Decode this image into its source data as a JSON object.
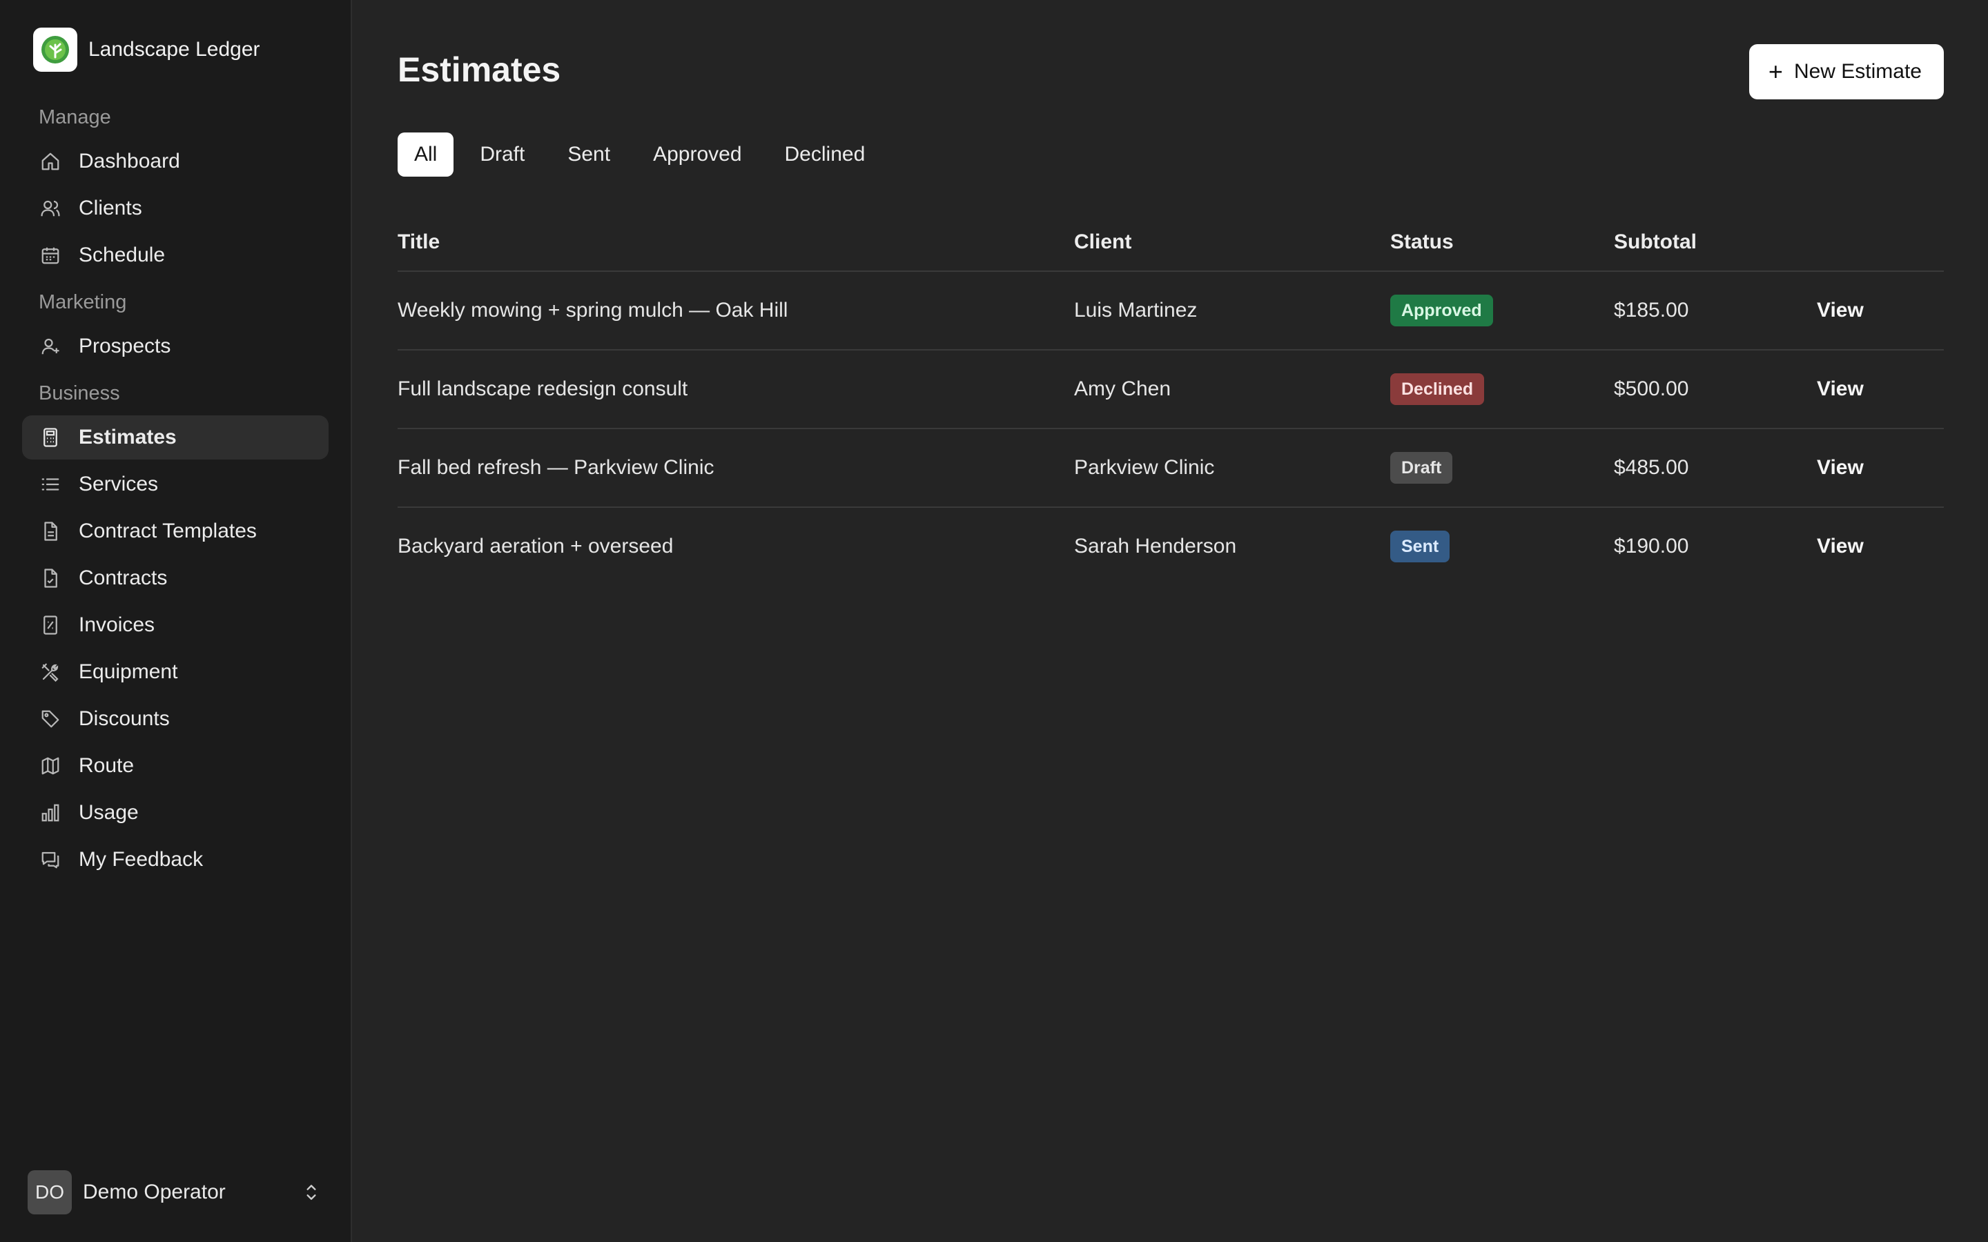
{
  "app": {
    "name": "Landscape Ledger"
  },
  "sidebar": {
    "sections": [
      {
        "label": "Manage",
        "items": [
          {
            "label": "Dashboard",
            "icon": "home-icon"
          },
          {
            "label": "Clients",
            "icon": "users-icon"
          },
          {
            "label": "Schedule",
            "icon": "calendar-icon"
          }
        ]
      },
      {
        "label": "Marketing",
        "items": [
          {
            "label": "Prospects",
            "icon": "user-plus-icon"
          }
        ]
      },
      {
        "label": "Business",
        "items": [
          {
            "label": "Estimates",
            "icon": "calculator-icon",
            "active": true
          },
          {
            "label": "Services",
            "icon": "list-icon"
          },
          {
            "label": "Contract Templates",
            "icon": "file-icon"
          },
          {
            "label": "Contracts",
            "icon": "file-check-icon"
          },
          {
            "label": "Invoices",
            "icon": "receipt-icon"
          },
          {
            "label": "Equipment",
            "icon": "tools-icon"
          },
          {
            "label": "Discounts",
            "icon": "tag-icon"
          },
          {
            "label": "Route",
            "icon": "map-icon"
          },
          {
            "label": "Usage",
            "icon": "bar-chart-icon"
          },
          {
            "label": "My Feedback",
            "icon": "feedback-icon"
          }
        ]
      }
    ],
    "user": {
      "initials": "DO",
      "name": "Demo Operator"
    }
  },
  "main": {
    "title": "Estimates",
    "new_button": "New Estimate",
    "tabs": [
      "All",
      "Draft",
      "Sent",
      "Approved",
      "Declined"
    ],
    "active_tab": "All",
    "columns": {
      "title": "Title",
      "client": "Client",
      "status": "Status",
      "subtotal": "Subtotal"
    },
    "rows": [
      {
        "title": "Weekly mowing + spring mulch — Oak Hill",
        "client": "Luis Martinez",
        "status": "Approved",
        "subtotal": "$185.00",
        "action": "View"
      },
      {
        "title": "Full landscape redesign consult",
        "client": "Amy Chen",
        "status": "Declined",
        "subtotal": "$500.00",
        "action": "View"
      },
      {
        "title": "Fall bed refresh — Parkview Clinic",
        "client": "Parkview Clinic",
        "status": "Draft",
        "subtotal": "$485.00",
        "action": "View"
      },
      {
        "title": "Backyard aeration + overseed",
        "client": "Sarah Henderson",
        "status": "Sent",
        "subtotal": "$190.00",
        "action": "View"
      }
    ]
  },
  "colors": {
    "background": "#242424",
    "sidebar": "#1b1b1b",
    "status": {
      "Approved": {
        "bg": "#1f7a45",
        "fg": "#d9f7e4"
      },
      "Declined": {
        "bg": "#8a3b3b",
        "fg": "#fbe1e1"
      },
      "Draft": {
        "bg": "#4c4c4c",
        "fg": "#e6e6e6"
      },
      "Sent": {
        "bg": "#345b86",
        "fg": "#dcebff"
      }
    }
  }
}
